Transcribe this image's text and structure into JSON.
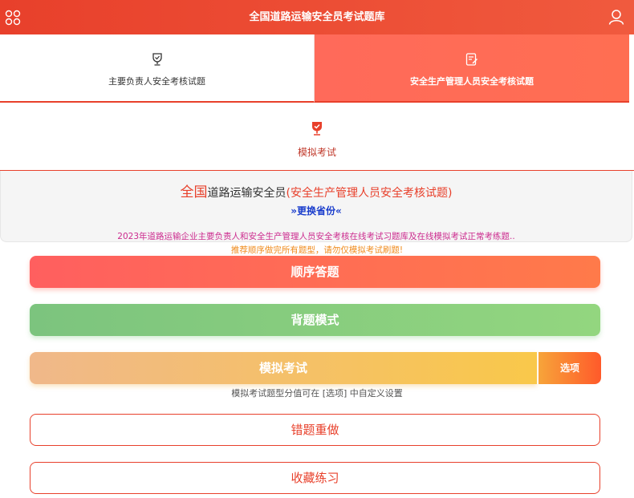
{
  "header": {
    "title": "全国道路运输安全员考试题库",
    "left_icon": "grid-icon",
    "right_icon": "user-icon"
  },
  "tabs": [
    {
      "label": "主要负责人安全考核试题",
      "icon": "trophy-icon",
      "active": false
    },
    {
      "label": "安全生产管理人员安全考核试题",
      "icon": "exam-edit-icon",
      "active": true
    }
  ],
  "mock_tab": {
    "label": "模拟考试",
    "icon": "trophy-icon"
  },
  "info": {
    "region": "全国",
    "category": "道路运输安全员",
    "subject": "(安全生产管理人员安全考核试题)",
    "change_label": "»更换省份«",
    "notice": "2023年道路运输企业主要负责人和安全生产管理人员安全考核在线考试习题库及在线模拟考试正常考练题.."
  },
  "tip": "推荐顺序做完所有题型，请勿仅模拟考试刷题!",
  "buttons": {
    "sequential": "顺序答题",
    "memorize": "背题模式",
    "mock_exam": "模拟考试",
    "options": "选项",
    "mock_note": "模拟考试题型分值可在 [选项] 中自定义设置",
    "wrong_redo": "错题重做",
    "favorites": "收藏练习"
  },
  "colors": {
    "primary": "#e8402b",
    "tab_active": "#ff6a5a",
    "memo_green": "#7cc47e",
    "mock_orange": "#f9c84a",
    "link_blue": "#1a3dcc",
    "notice_pink": "#cc2b8e"
  }
}
